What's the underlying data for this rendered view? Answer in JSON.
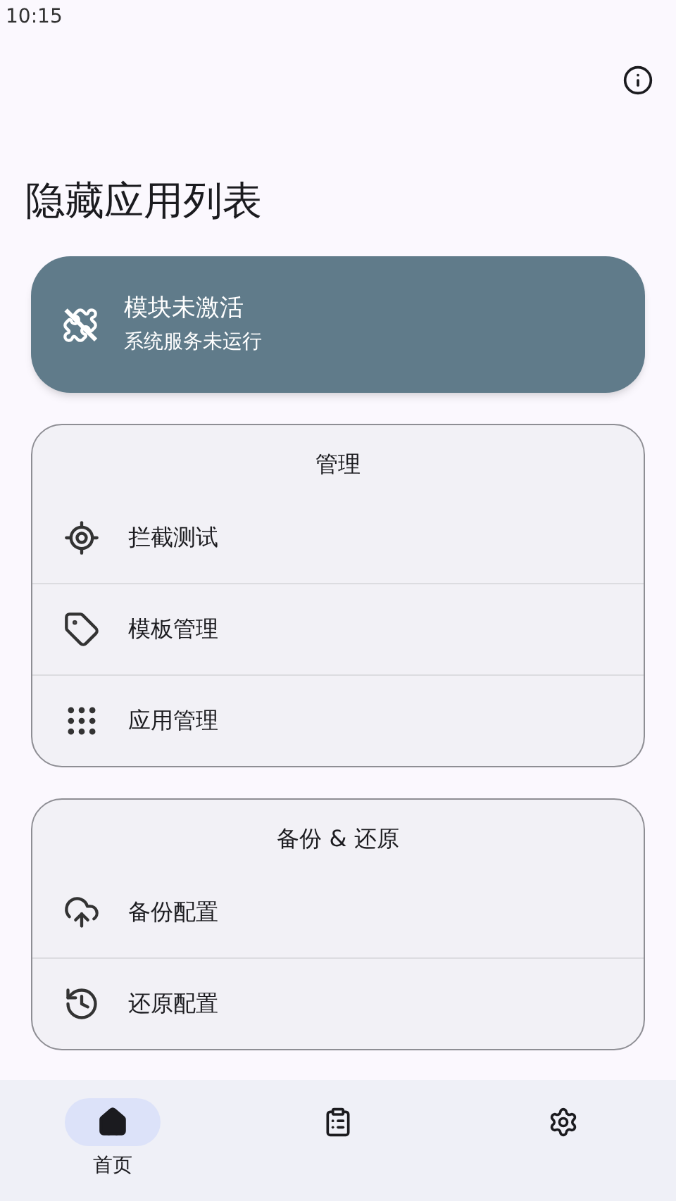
{
  "status_bar": {
    "time": "10:15"
  },
  "title": "隐藏应用列表",
  "status_card": {
    "title": "模块未激活",
    "subtitle": "系统服务未运行",
    "active": false
  },
  "sections": [
    {
      "title": "管理",
      "items": [
        {
          "label": "拦截测试"
        },
        {
          "label": "模板管理"
        },
        {
          "label": "应用管理"
        }
      ]
    },
    {
      "title": "备份 & 还原",
      "items": [
        {
          "label": "备份配置"
        },
        {
          "label": "还原配置"
        }
      ]
    }
  ],
  "nav": [
    {
      "label": "首页",
      "selected": true
    },
    {
      "selected": false
    },
    {
      "selected": false
    }
  ]
}
